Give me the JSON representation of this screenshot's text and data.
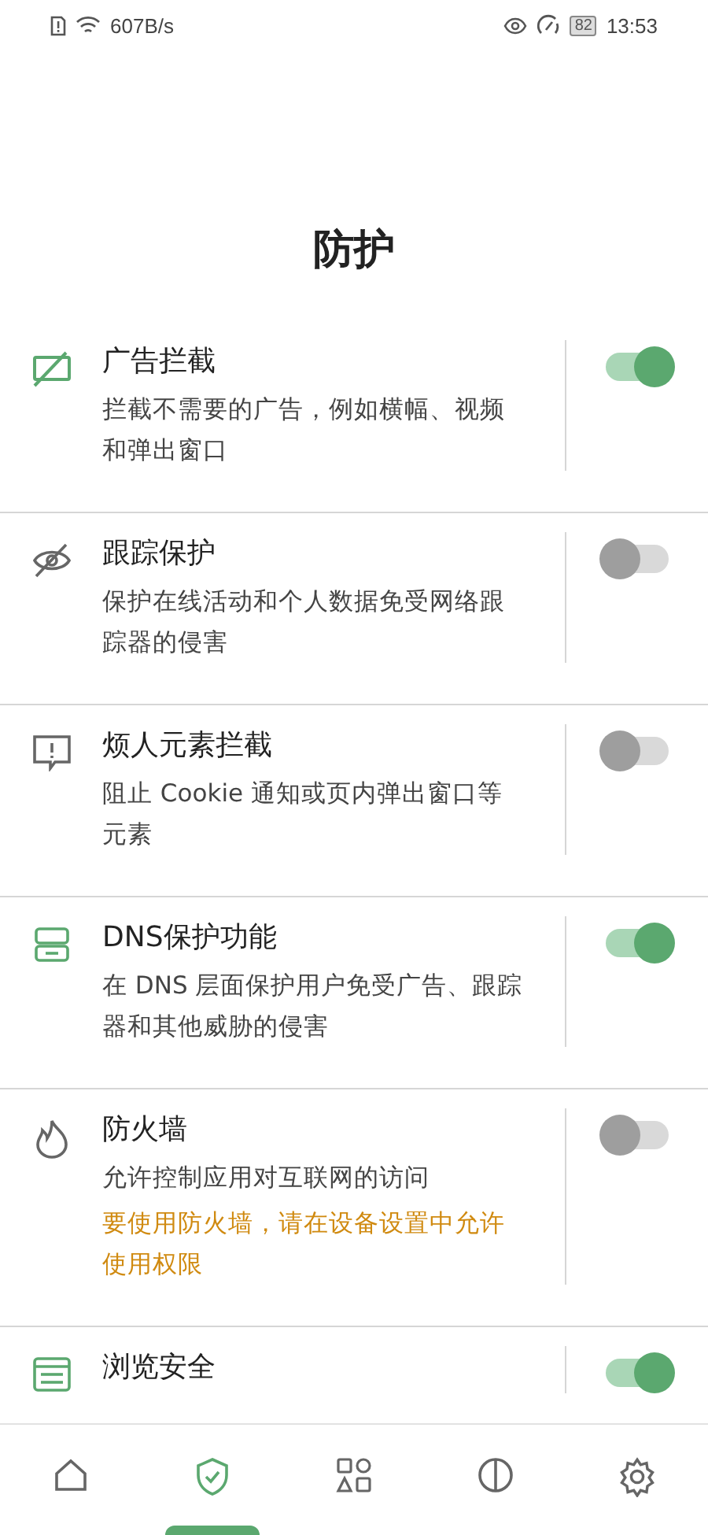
{
  "status_bar": {
    "speed": "607B/s",
    "battery": "82",
    "time": "13:53"
  },
  "title": "防护",
  "features": [
    {
      "title": "广告拦截",
      "description": "拦截不需要的广告，例如横幅、视频和弹出窗口",
      "on": true
    },
    {
      "title": "跟踪保护",
      "description": "保护在线活动和个人数据免受网络跟踪器的侵害",
      "on": false
    },
    {
      "title": "烦人元素拦截",
      "description": "阻止 Cookie 通知或页内弹出窗口等元素",
      "on": false
    },
    {
      "title": "DNS保护功能",
      "description": "在 DNS 层面保护用户免受广告、跟踪器和其他威胁的侵害",
      "on": true
    },
    {
      "title": "防火墙",
      "description": "允许控制应用对互联网的访问",
      "warning": "要使用防火墙，请在设备设置中允许使用权限",
      "on": false
    },
    {
      "title": "浏览安全",
      "on": true
    }
  ],
  "nav": [
    {
      "selected": false
    },
    {
      "selected": true
    },
    {
      "selected": false
    },
    {
      "selected": false
    },
    {
      "selected": false
    }
  ]
}
